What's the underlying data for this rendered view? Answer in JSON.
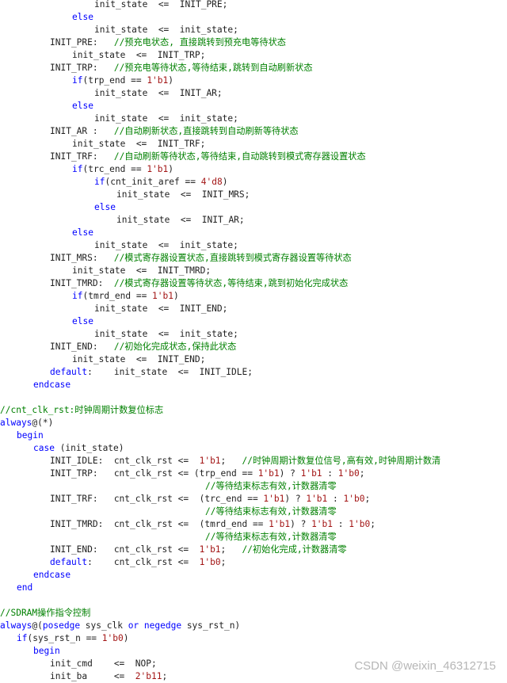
{
  "colors": {
    "background": "#ffffff",
    "plain": "#1f1f1f",
    "keyword": "#0000ff",
    "number": "#a31515",
    "comment": "#008000",
    "watermark": "#b6b6b6"
  },
  "code_lines": [
    {
      "indent": 17,
      "tokens": [
        [
          "plain",
          "init_state  <=  INIT_PRE;"
        ]
      ]
    },
    {
      "indent": 13,
      "tokens": [
        [
          "kw",
          "else"
        ]
      ]
    },
    {
      "indent": 17,
      "tokens": [
        [
          "plain",
          "init_state  <=  init_state;"
        ]
      ]
    },
    {
      "indent": 9,
      "tokens": [
        [
          "plain",
          "INIT_PRE:   "
        ],
        [
          "cm",
          "//预充电状态, 直接跳转到预充电等待状态"
        ]
      ]
    },
    {
      "indent": 13,
      "tokens": [
        [
          "plain",
          "init_state  <=  INIT_TRP;"
        ]
      ]
    },
    {
      "indent": 9,
      "tokens": [
        [
          "plain",
          "INIT_TRP:   "
        ],
        [
          "cm",
          "//预充电等待状态,等待结束,跳转到自动刷新状态"
        ]
      ]
    },
    {
      "indent": 13,
      "tokens": [
        [
          "kw",
          "if"
        ],
        [
          "plain",
          "(trp_end == "
        ],
        [
          "num",
          "1'b1"
        ],
        [
          "plain",
          ")"
        ]
      ]
    },
    {
      "indent": 17,
      "tokens": [
        [
          "plain",
          "init_state  <=  INIT_AR;"
        ]
      ]
    },
    {
      "indent": 13,
      "tokens": [
        [
          "kw",
          "else"
        ]
      ]
    },
    {
      "indent": 17,
      "tokens": [
        [
          "plain",
          "init_state  <=  init_state;"
        ]
      ]
    },
    {
      "indent": 9,
      "tokens": [
        [
          "plain",
          "INIT_AR :   "
        ],
        [
          "cm",
          "//自动刷新状态,直接跳转到自动刷新等待状态"
        ]
      ]
    },
    {
      "indent": 13,
      "tokens": [
        [
          "plain",
          "init_state  <=  INIT_TRF;"
        ]
      ]
    },
    {
      "indent": 9,
      "tokens": [
        [
          "plain",
          "INIT_TRF:   "
        ],
        [
          "cm",
          "//自动刷新等待状态,等待结束,自动跳转到模式寄存器设置状态"
        ]
      ]
    },
    {
      "indent": 13,
      "tokens": [
        [
          "kw",
          "if"
        ],
        [
          "plain",
          "(trc_end == "
        ],
        [
          "num",
          "1'b1"
        ],
        [
          "plain",
          ")"
        ]
      ]
    },
    {
      "indent": 17,
      "tokens": [
        [
          "kw",
          "if"
        ],
        [
          "plain",
          "(cnt_init_aref == "
        ],
        [
          "num",
          "4'd8"
        ],
        [
          "plain",
          ")"
        ]
      ]
    },
    {
      "indent": 21,
      "tokens": [
        [
          "plain",
          "init_state  <=  INIT_MRS;"
        ]
      ]
    },
    {
      "indent": 17,
      "tokens": [
        [
          "kw",
          "else"
        ]
      ]
    },
    {
      "indent": 21,
      "tokens": [
        [
          "plain",
          "init_state  <=  INIT_AR;"
        ]
      ]
    },
    {
      "indent": 13,
      "tokens": [
        [
          "kw",
          "else"
        ]
      ]
    },
    {
      "indent": 17,
      "tokens": [
        [
          "plain",
          "init_state  <=  init_state;"
        ]
      ]
    },
    {
      "indent": 9,
      "tokens": [
        [
          "plain",
          "INIT_MRS:   "
        ],
        [
          "cm",
          "//模式寄存器设置状态,直接跳转到模式寄存器设置等待状态"
        ]
      ]
    },
    {
      "indent": 13,
      "tokens": [
        [
          "plain",
          "init_state  <=  INIT_TMRD;"
        ]
      ]
    },
    {
      "indent": 9,
      "tokens": [
        [
          "plain",
          "INIT_TMRD:  "
        ],
        [
          "cm",
          "//模式寄存器设置等待状态,等待结束,跳到初始化完成状态"
        ]
      ]
    },
    {
      "indent": 13,
      "tokens": [
        [
          "kw",
          "if"
        ],
        [
          "plain",
          "(tmrd_end == "
        ],
        [
          "num",
          "1'b1"
        ],
        [
          "plain",
          ")"
        ]
      ]
    },
    {
      "indent": 17,
      "tokens": [
        [
          "plain",
          "init_state  <=  INIT_END;"
        ]
      ]
    },
    {
      "indent": 13,
      "tokens": [
        [
          "kw",
          "else"
        ]
      ]
    },
    {
      "indent": 17,
      "tokens": [
        [
          "plain",
          "init_state  <=  init_state;"
        ]
      ]
    },
    {
      "indent": 9,
      "tokens": [
        [
          "plain",
          "INIT_END:   "
        ],
        [
          "cm",
          "//初始化完成状态,保持此状态"
        ]
      ]
    },
    {
      "indent": 13,
      "tokens": [
        [
          "plain",
          "init_state  <=  INIT_END;"
        ]
      ]
    },
    {
      "indent": 9,
      "tokens": [
        [
          "kw",
          "default"
        ],
        [
          "plain",
          ":    init_state  <=  INIT_IDLE;"
        ]
      ]
    },
    {
      "indent": 6,
      "tokens": [
        [
          "kw",
          "endcase"
        ]
      ]
    },
    {
      "indent": 0,
      "tokens": []
    },
    {
      "indent": 0,
      "tokens": [
        [
          "cm",
          "//cnt_clk_rst:时钟周期计数复位标志"
        ]
      ]
    },
    {
      "indent": 0,
      "tokens": [
        [
          "kw",
          "always"
        ],
        [
          "plain",
          "@(*)"
        ]
      ]
    },
    {
      "indent": 3,
      "tokens": [
        [
          "kw",
          "begin"
        ]
      ]
    },
    {
      "indent": 6,
      "tokens": [
        [
          "kw",
          "case"
        ],
        [
          "plain",
          " (init_state)"
        ]
      ]
    },
    {
      "indent": 9,
      "tokens": [
        [
          "plain",
          "INIT_IDLE:  cnt_clk_rst <=  "
        ],
        [
          "num",
          "1'b1"
        ],
        [
          "plain",
          ";   "
        ],
        [
          "cm",
          "//时钟周期计数复位信号,高有效,时钟周期计数清"
        ]
      ]
    },
    {
      "indent": 9,
      "tokens": [
        [
          "plain",
          "INIT_TRP:   cnt_clk_rst <= (trp_end == "
        ],
        [
          "num",
          "1'b1"
        ],
        [
          "plain",
          ") ? "
        ],
        [
          "num",
          "1'b1"
        ],
        [
          "plain",
          " : "
        ],
        [
          "num",
          "1'b0"
        ],
        [
          "plain",
          ";"
        ]
      ]
    },
    {
      "indent": 37,
      "tokens": [
        [
          "cm",
          "//等待结束标志有效,计数器清零"
        ]
      ]
    },
    {
      "indent": 9,
      "tokens": [
        [
          "plain",
          "INIT_TRF:   cnt_clk_rst <=  (trc_end == "
        ],
        [
          "num",
          "1'b1"
        ],
        [
          "plain",
          ") ? "
        ],
        [
          "num",
          "1'b1"
        ],
        [
          "plain",
          " : "
        ],
        [
          "num",
          "1'b0"
        ],
        [
          "plain",
          ";"
        ]
      ]
    },
    {
      "indent": 37,
      "tokens": [
        [
          "cm",
          "//等待结束标志有效,计数器清零"
        ]
      ]
    },
    {
      "indent": 9,
      "tokens": [
        [
          "plain",
          "INIT_TMRD:  cnt_clk_rst <=  (tmrd_end == "
        ],
        [
          "num",
          "1'b1"
        ],
        [
          "plain",
          ") ? "
        ],
        [
          "num",
          "1'b1"
        ],
        [
          "plain",
          " : "
        ],
        [
          "num",
          "1'b0"
        ],
        [
          "plain",
          ";"
        ]
      ]
    },
    {
      "indent": 37,
      "tokens": [
        [
          "cm",
          "//等待结束标志有效,计数器清零"
        ]
      ]
    },
    {
      "indent": 9,
      "tokens": [
        [
          "plain",
          "INIT_END:   cnt_clk_rst <=  "
        ],
        [
          "num",
          "1'b1"
        ],
        [
          "plain",
          ";   "
        ],
        [
          "cm",
          "//初始化完成,计数器清零"
        ]
      ]
    },
    {
      "indent": 9,
      "tokens": [
        [
          "kw",
          "default"
        ],
        [
          "plain",
          ":    cnt_clk_rst <=  "
        ],
        [
          "num",
          "1'b0"
        ],
        [
          "plain",
          ";"
        ]
      ]
    },
    {
      "indent": 6,
      "tokens": [
        [
          "kw",
          "endcase"
        ]
      ]
    },
    {
      "indent": 3,
      "tokens": [
        [
          "kw",
          "end"
        ]
      ]
    },
    {
      "indent": 0,
      "tokens": []
    },
    {
      "indent": 0,
      "tokens": [
        [
          "cm",
          "//SDRAM操作指令控制"
        ]
      ]
    },
    {
      "indent": 0,
      "tokens": [
        [
          "kw",
          "always"
        ],
        [
          "plain",
          "@("
        ],
        [
          "kw",
          "posedge"
        ],
        [
          "plain",
          " sys_clk "
        ],
        [
          "kw",
          "or"
        ],
        [
          "plain",
          " "
        ],
        [
          "kw",
          "negedge"
        ],
        [
          "plain",
          " sys_rst_n)"
        ]
      ]
    },
    {
      "indent": 3,
      "tokens": [
        [
          "kw",
          "if"
        ],
        [
          "plain",
          "(sys_rst_n == "
        ],
        [
          "num",
          "1'b0"
        ],
        [
          "plain",
          ")"
        ]
      ]
    },
    {
      "indent": 6,
      "tokens": [
        [
          "kw",
          "begin"
        ]
      ]
    },
    {
      "indent": 9,
      "tokens": [
        [
          "plain",
          "init_cmd    <=  NOP;"
        ]
      ]
    },
    {
      "indent": 9,
      "tokens": [
        [
          "plain",
          "init_ba     <=  "
        ],
        [
          "num",
          "2'b11"
        ],
        [
          "plain",
          ";"
        ]
      ]
    }
  ],
  "watermark": "CSDN @weixin_46312715"
}
